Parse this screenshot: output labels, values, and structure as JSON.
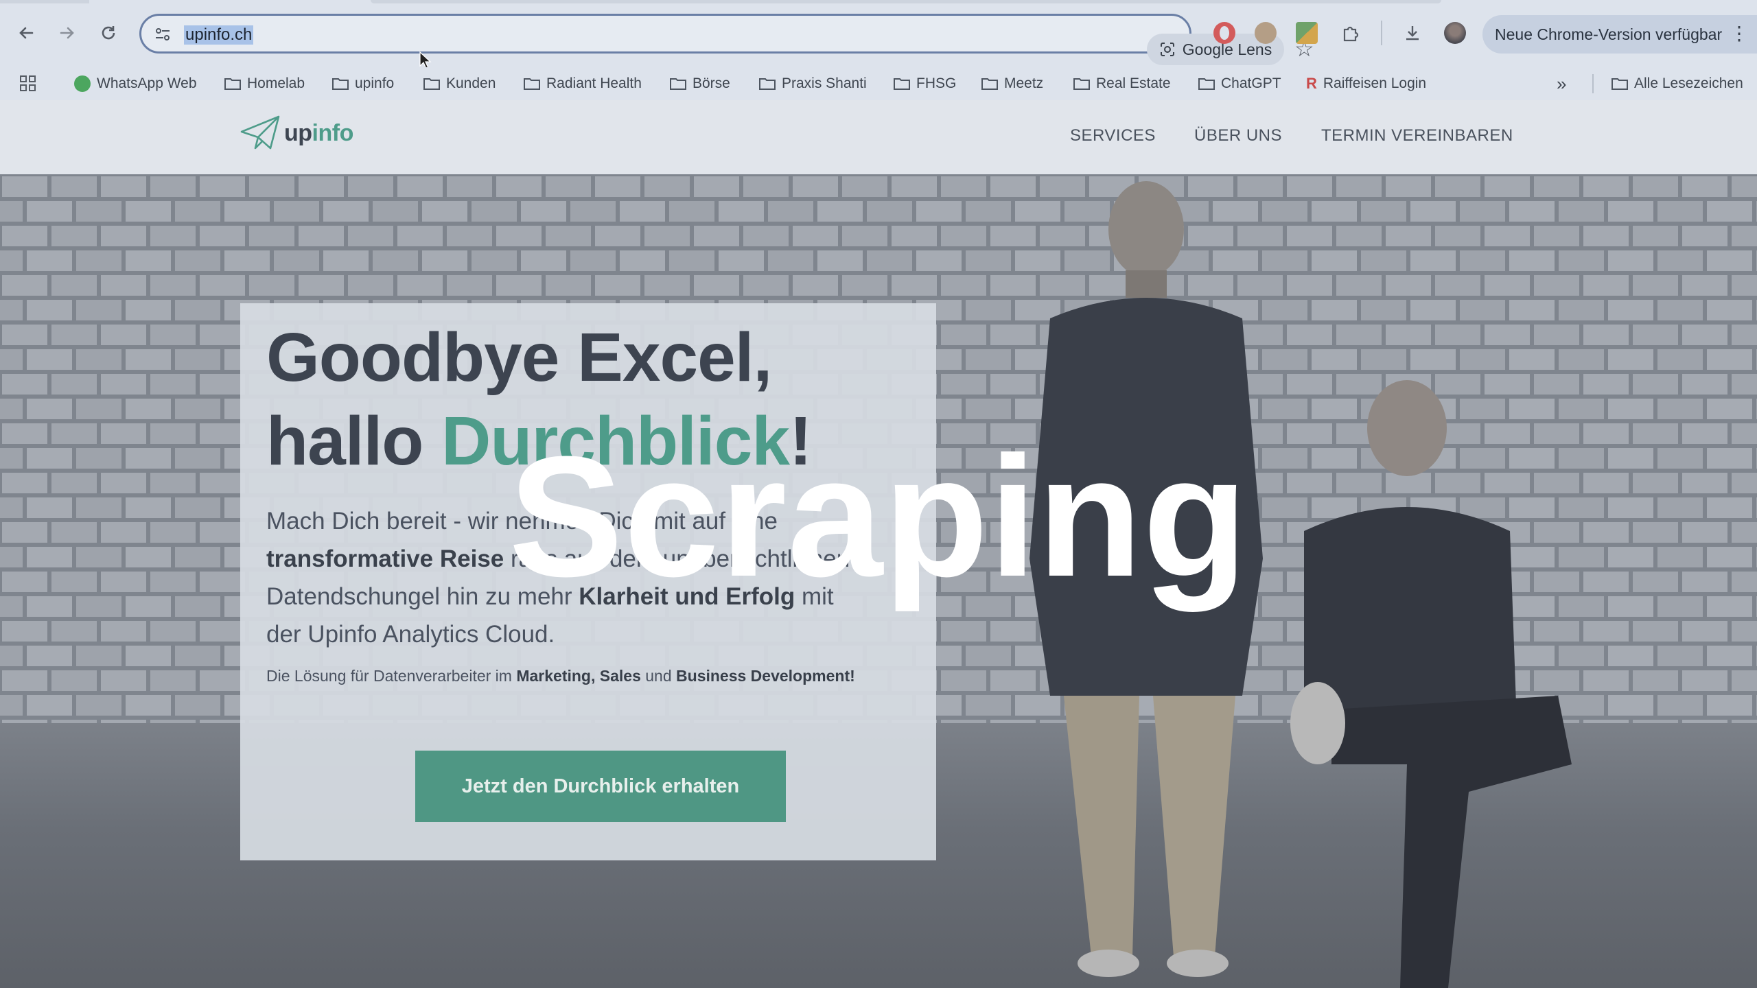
{
  "browser": {
    "url": "upinfo.ch",
    "lens_label": "Google Lens",
    "update_label": "Neue Chrome-Version verfügbar",
    "bookmarks": [
      {
        "label": "WhatsApp Web",
        "icon": "whatsapp-icon"
      },
      {
        "label": "Homelab",
        "icon": "folder-icon"
      },
      {
        "label": "upinfo",
        "icon": "folder-icon"
      },
      {
        "label": "Kunden",
        "icon": "folder-icon"
      },
      {
        "label": "Radiant Health",
        "icon": "folder-icon"
      },
      {
        "label": "Börse",
        "icon": "folder-icon"
      },
      {
        "label": "Praxis Shanti",
        "icon": "folder-icon"
      },
      {
        "label": "FHSG",
        "icon": "folder-icon"
      },
      {
        "label": "Meetz",
        "icon": "folder-icon"
      },
      {
        "label": "Real Estate",
        "icon": "folder-icon"
      },
      {
        "label": "ChatGPT",
        "icon": "folder-icon"
      },
      {
        "label": "Raiffeisen Login",
        "icon": "raiffeisen-icon"
      }
    ],
    "all_bookmarks_label": "Alle Lesezeichen",
    "overflow_label": "»"
  },
  "site": {
    "logo_prefix": "up",
    "logo_suffix": "info",
    "nav": [
      "SERVICES",
      "ÜBER UNS",
      "TERMIN VEREINBAREN"
    ],
    "hero": {
      "headline_line1": "Goodbye Excel,",
      "headline_line2_prefix": "hallo ",
      "headline_line2_accent": "Durchblick",
      "headline_line2_suffix": "!",
      "body_1": "Mach Dich bereit - wir nehmen Dich mit auf eine",
      "body_2_bold": "transformative Reise",
      "body_2": " raus aus dem unübersichtlichen",
      "body_3": "Datendschungel hin zu mehr ",
      "body_3_bold": "Klarheit und Erfolg",
      "body_3_end": " mit",
      "body_4": "der Upinfo Analytics Cloud.",
      "tagline_1": "Die Lösung für Datenverarbeiter im ",
      "tagline_bold_1": "Marketing, Sales",
      "tagline_2": " und ",
      "tagline_bold_2": "Business Development!",
      "cta_label": "Jetzt den Durchblick erhalten"
    }
  },
  "overlay_title": "Scraping",
  "colors": {
    "accent": "#4e9c8a",
    "cta": "#4f9784",
    "omnibox_border": "#6a7fa6"
  }
}
